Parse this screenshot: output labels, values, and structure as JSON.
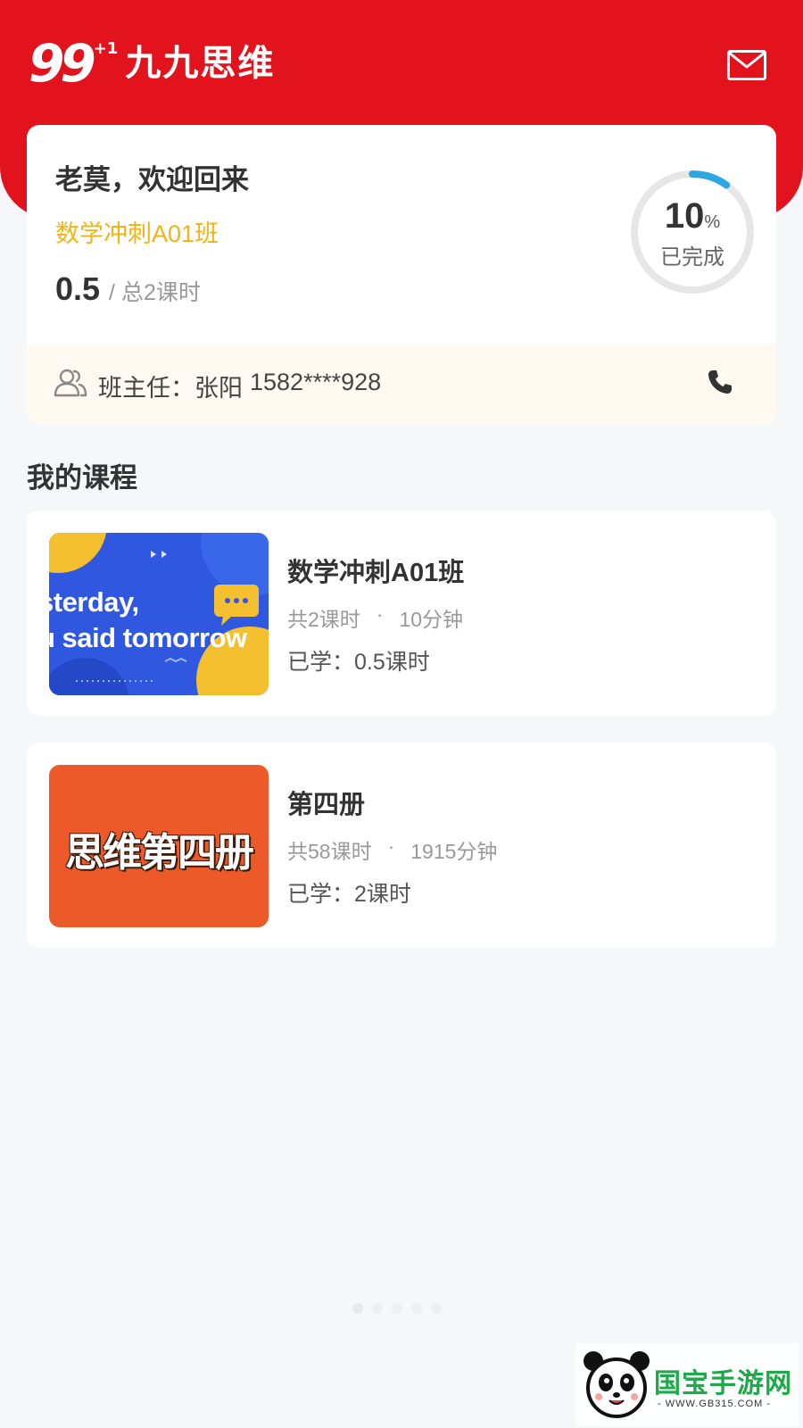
{
  "header": {
    "logo_number": "99",
    "logo_plus": "+1",
    "logo_text": "九九思维",
    "mail_icon": "mail-icon"
  },
  "welcome": {
    "greeting": "老莫，欢迎回来",
    "class_name": "数学冲刺A01班",
    "hours_done": "0.5",
    "hours_total": "/ 总2课时",
    "progress_value": "10",
    "progress_unit": "%",
    "progress_fraction": 0.1,
    "progress_label": "已完成"
  },
  "teacher": {
    "label": "班主任：张阳",
    "phone": "1582****928",
    "icon": "users-icon",
    "call_icon": "phone-icon"
  },
  "courses_section": {
    "title": "我的课程"
  },
  "courses": [
    {
      "title": "数学冲刺A01班",
      "lessons": "共2课时",
      "duration": "10分钟",
      "progress": "已学：0.5课时",
      "thumb_line1": "sterday,",
      "thumb_line2": "u said tomorrow"
    },
    {
      "title": "第四册",
      "lessons": "共58课时",
      "duration": "1915分钟",
      "progress": "已学：2课时",
      "thumb_text": "思维第四册"
    }
  ],
  "watermark": {
    "text": "国宝手游网",
    "url": "- WWW.GB315.COM -"
  },
  "colors": {
    "header_red": "#e3131e",
    "class_yellow": "#f0b416",
    "progress_blue": "#2ea7e0",
    "teacher_bar_bg": "#fff9f1"
  }
}
